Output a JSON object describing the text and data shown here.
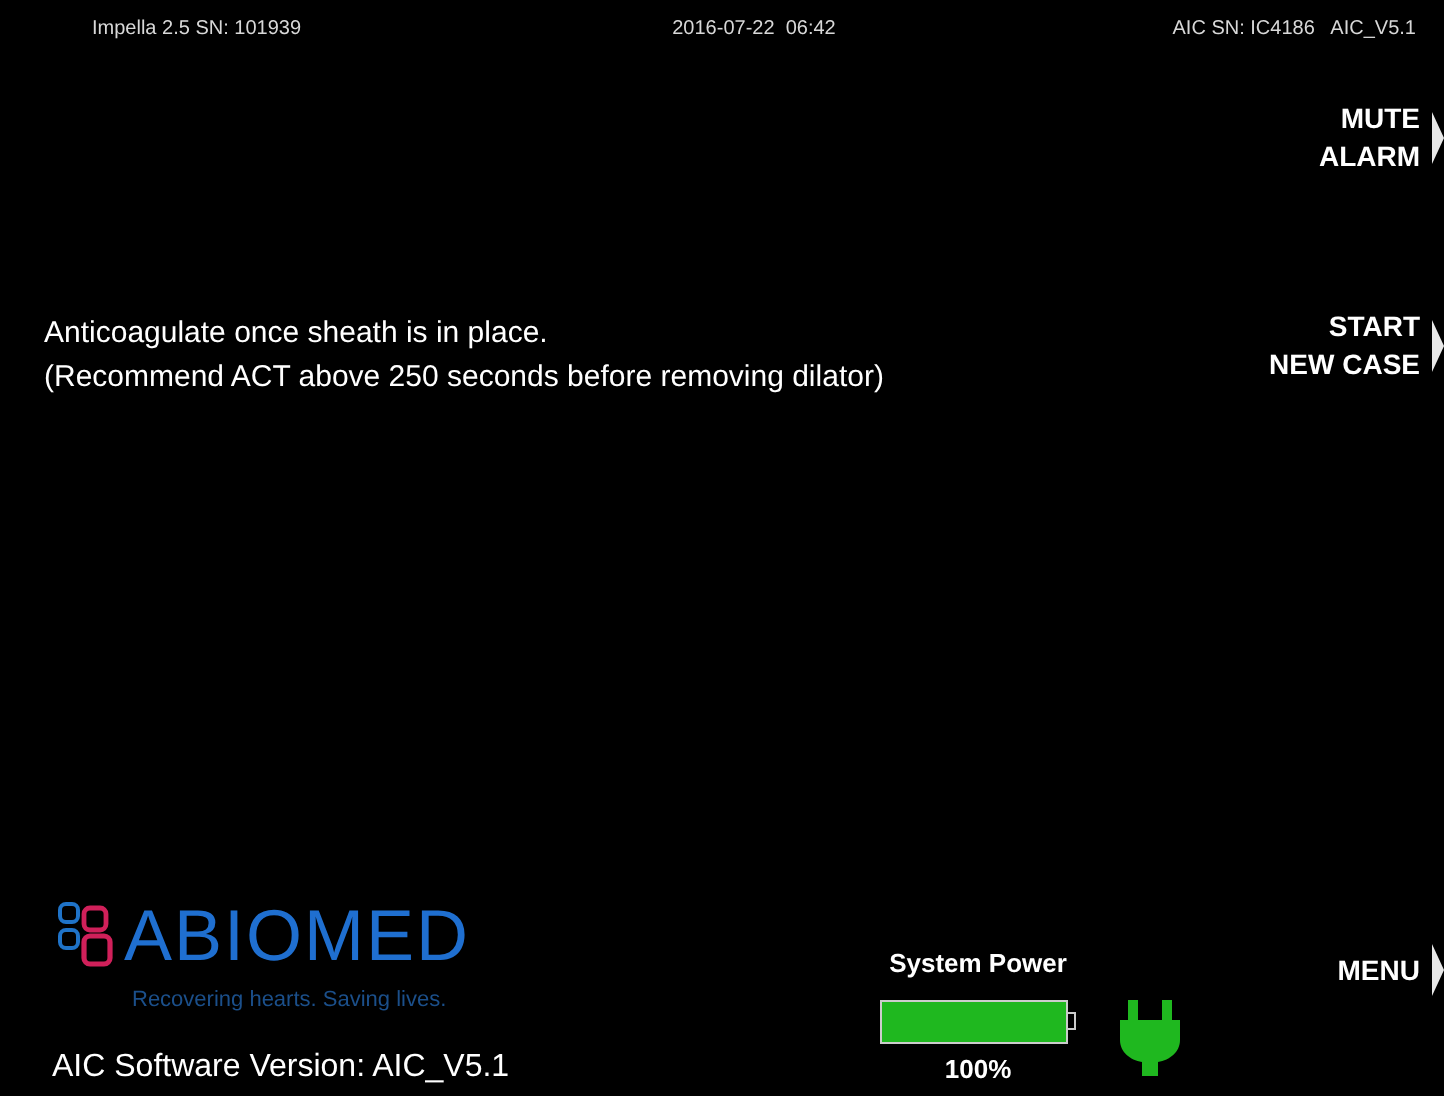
{
  "header": {
    "pump": "Impella 2.5 SN: 101939",
    "datetime": "2016-07-22  06:42",
    "controller": "AIC SN: IC4186   AIC_V5.1"
  },
  "message": [
    "Anticoagulate once sheath is in place.",
    "(Recommend ACT above 250 seconds before removing dilator)"
  ],
  "soft_keys": [
    {
      "label": "MUTE ALARM"
    },
    {
      "label": "START NEW CASE"
    },
    {
      "label": "MENU"
    }
  ],
  "logo": {
    "name": "ABIOMED",
    "tagline": "Recovering hearts. Saving lives."
  },
  "software_version": "AIC Software Version: AIC_V5.1",
  "system_power": {
    "title": "System Power",
    "level": 1.0,
    "reading": "100%",
    "plugged_in": true
  }
}
